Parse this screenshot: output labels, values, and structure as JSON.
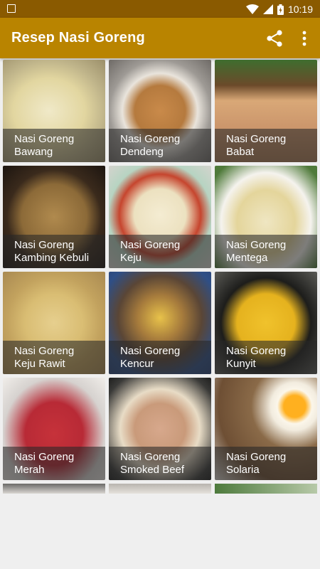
{
  "status_bar": {
    "time": "10:19",
    "icons": [
      "image-icon",
      "wifi-icon",
      "signal-icon",
      "battery-icon"
    ]
  },
  "app_bar": {
    "title": "Resep Nasi Goreng",
    "actions": [
      "share-icon",
      "more-vert-icon"
    ]
  },
  "colors": {
    "status_bar": "#8a5a00",
    "app_bar": "#b98400",
    "caption_overlay": "rgba(40,40,40,0.58)"
  },
  "recipes": [
    {
      "line1": "Nasi Goreng",
      "line2": "Bawang"
    },
    {
      "line1": "Nasi Goreng",
      "line2": "Dendeng"
    },
    {
      "line1": "Nasi Goreng",
      "line2": "Babat"
    },
    {
      "line1": "Nasi Goreng",
      "line2": "Kambing Kebuli"
    },
    {
      "line1": "Nasi Goreng",
      "line2": "Keju"
    },
    {
      "line1": "Nasi Goreng",
      "line2": "Mentega"
    },
    {
      "line1": "Nasi Goreng",
      "line2": "Keju Rawit"
    },
    {
      "line1": "Nasi Goreng",
      "line2": "Kencur"
    },
    {
      "line1": "Nasi Goreng",
      "line2": "Kunyit"
    },
    {
      "line1": "Nasi Goreng",
      "line2": "Merah"
    },
    {
      "line1": "Nasi Goreng",
      "line2": "Smoked Beef"
    },
    {
      "line1": "Nasi Goreng",
      "line2": "Solaria"
    }
  ]
}
